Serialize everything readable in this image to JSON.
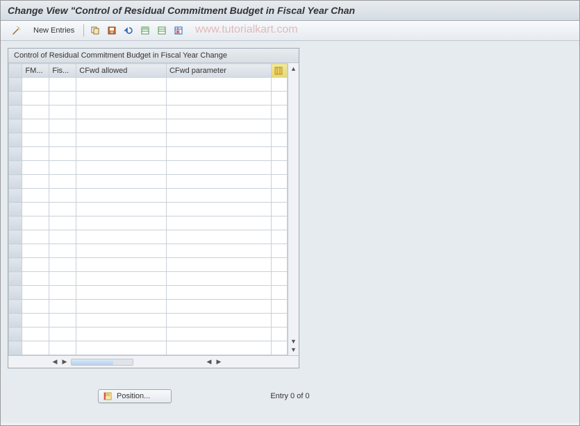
{
  "title": "Change View \"Control of Residual Commitment Budget in Fiscal Year Chan",
  "watermark": "www.tutorialkart.com",
  "toolbar": {
    "new_entries_label": "New Entries"
  },
  "table": {
    "caption": "Control of Residual Commitment Budget in Fiscal Year Change",
    "columns": {
      "fm": "FM...",
      "fis": "Fis...",
      "cfwd_allowed": "CFwd allowed",
      "cfwd_parameter": "CFwd parameter"
    },
    "empty_rows": 20
  },
  "footer": {
    "position_label": "Position...",
    "entry_text": "Entry 0 of 0"
  }
}
